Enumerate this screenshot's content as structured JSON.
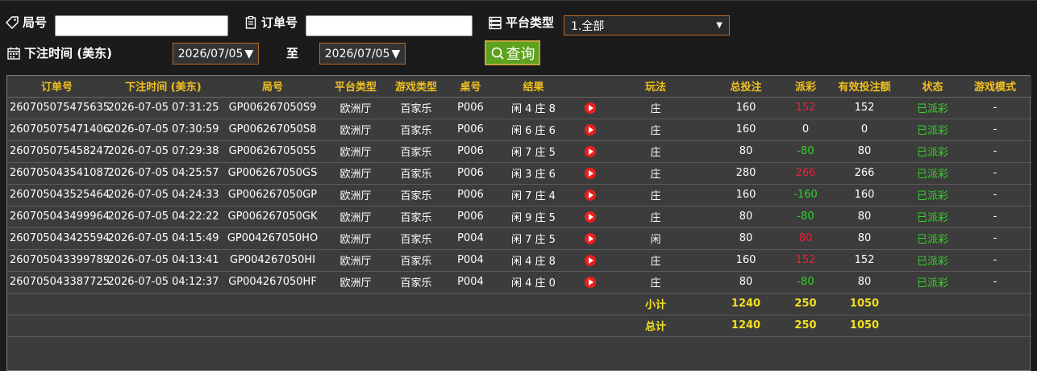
{
  "filters": {
    "round_label": "局号",
    "round_value": "",
    "order_label": "订单号",
    "order_value": "",
    "platform_label": "平台类型",
    "platform_selected": "1.全部",
    "time_label": "下注时间 (美东)",
    "date_from": "2026/07/05",
    "to_label": "至",
    "date_to": "2026/07/05",
    "query_label": "查询"
  },
  "table": {
    "headers": [
      "订单号",
      "下注时间 (美东)",
      "局号",
      "平台类型",
      "游戏类型",
      "桌号",
      "结果",
      "",
      "玩法",
      "总投注",
      "派彩",
      "有效投注额",
      "状态",
      "游戏模式"
    ],
    "rows": [
      {
        "order": "260705075475635",
        "time": "2026-07-05 07:31:25",
        "round": "GP006267050S9",
        "platform": "欧洲厅",
        "game": "百家乐",
        "table": "P006",
        "result": "闲 4 庄 8",
        "play": "庄",
        "bet": "160",
        "payout": "152",
        "valid": "152",
        "status": "已派彩",
        "mode": "-"
      },
      {
        "order": "260705075471406",
        "time": "2026-07-05 07:30:59",
        "round": "GP006267050S8",
        "platform": "欧洲厅",
        "game": "百家乐",
        "table": "P006",
        "result": "闲 6 庄 6",
        "play": "庄",
        "bet": "160",
        "payout": "0",
        "valid": "0",
        "status": "已派彩",
        "mode": "-"
      },
      {
        "order": "260705075458247",
        "time": "2026-07-05 07:29:38",
        "round": "GP006267050S5",
        "platform": "欧洲厅",
        "game": "百家乐",
        "table": "P006",
        "result": "闲 7 庄 5",
        "play": "庄",
        "bet": "80",
        "payout": "-80",
        "valid": "80",
        "status": "已派彩",
        "mode": "-"
      },
      {
        "order": "260705043541087",
        "time": "2026-07-05 04:25:57",
        "round": "GP006267050GS",
        "platform": "欧洲厅",
        "game": "百家乐",
        "table": "P006",
        "result": "闲 3 庄 6",
        "play": "庄",
        "bet": "280",
        "payout": "266",
        "valid": "266",
        "status": "已派彩",
        "mode": "-"
      },
      {
        "order": "260705043525464",
        "time": "2026-07-05 04:24:33",
        "round": "GP006267050GP",
        "platform": "欧洲厅",
        "game": "百家乐",
        "table": "P006",
        "result": "闲 7 庄 4",
        "play": "庄",
        "bet": "160",
        "payout": "-160",
        "valid": "160",
        "status": "已派彩",
        "mode": "-"
      },
      {
        "order": "260705043499964",
        "time": "2026-07-05 04:22:22",
        "round": "GP006267050GK",
        "platform": "欧洲厅",
        "game": "百家乐",
        "table": "P006",
        "result": "闲 9 庄 5",
        "play": "庄",
        "bet": "80",
        "payout": "-80",
        "valid": "80",
        "status": "已派彩",
        "mode": "-"
      },
      {
        "order": "260705043425594",
        "time": "2026-07-05 04:15:49",
        "round": "GP004267050HO",
        "platform": "欧洲厅",
        "game": "百家乐",
        "table": "P004",
        "result": "闲 7 庄 5",
        "play": "闲",
        "bet": "80",
        "payout": "80",
        "valid": "80",
        "status": "已派彩",
        "mode": "-"
      },
      {
        "order": "260705043399789",
        "time": "2026-07-05 04:13:41",
        "round": "GP004267050HI",
        "platform": "欧洲厅",
        "game": "百家乐",
        "table": "P004",
        "result": "闲 4 庄 8",
        "play": "庄",
        "bet": "160",
        "payout": "152",
        "valid": "152",
        "status": "已派彩",
        "mode": "-"
      },
      {
        "order": "260705043387725",
        "time": "2026-07-05 04:12:37",
        "round": "GP004267050HF",
        "platform": "欧洲厅",
        "game": "百家乐",
        "table": "P004",
        "result": "闲 4 庄 0",
        "play": "庄",
        "bet": "80",
        "payout": "-80",
        "valid": "80",
        "status": "已派彩",
        "mode": "-"
      }
    ],
    "subtotal": {
      "label": "小计",
      "bet": "1240",
      "payout": "250",
      "valid": "1050"
    },
    "total": {
      "label": "总计",
      "bet": "1240",
      "payout": "250",
      "valid": "1050"
    }
  },
  "colors": {
    "positive_payout": "#e2233a",
    "negative_payout": "#34d12a",
    "header_text": "#f0c020",
    "status_settled": "#34d12a",
    "summary_text": "#f0e020",
    "accent_border": "#b36b2c",
    "query_button": "#5da21d"
  },
  "icons": {
    "round": "tag-icon",
    "order": "clipboard-icon",
    "platform": "server-icon",
    "time": "calendar-icon",
    "query": "search-icon",
    "replay": "play-icon"
  }
}
